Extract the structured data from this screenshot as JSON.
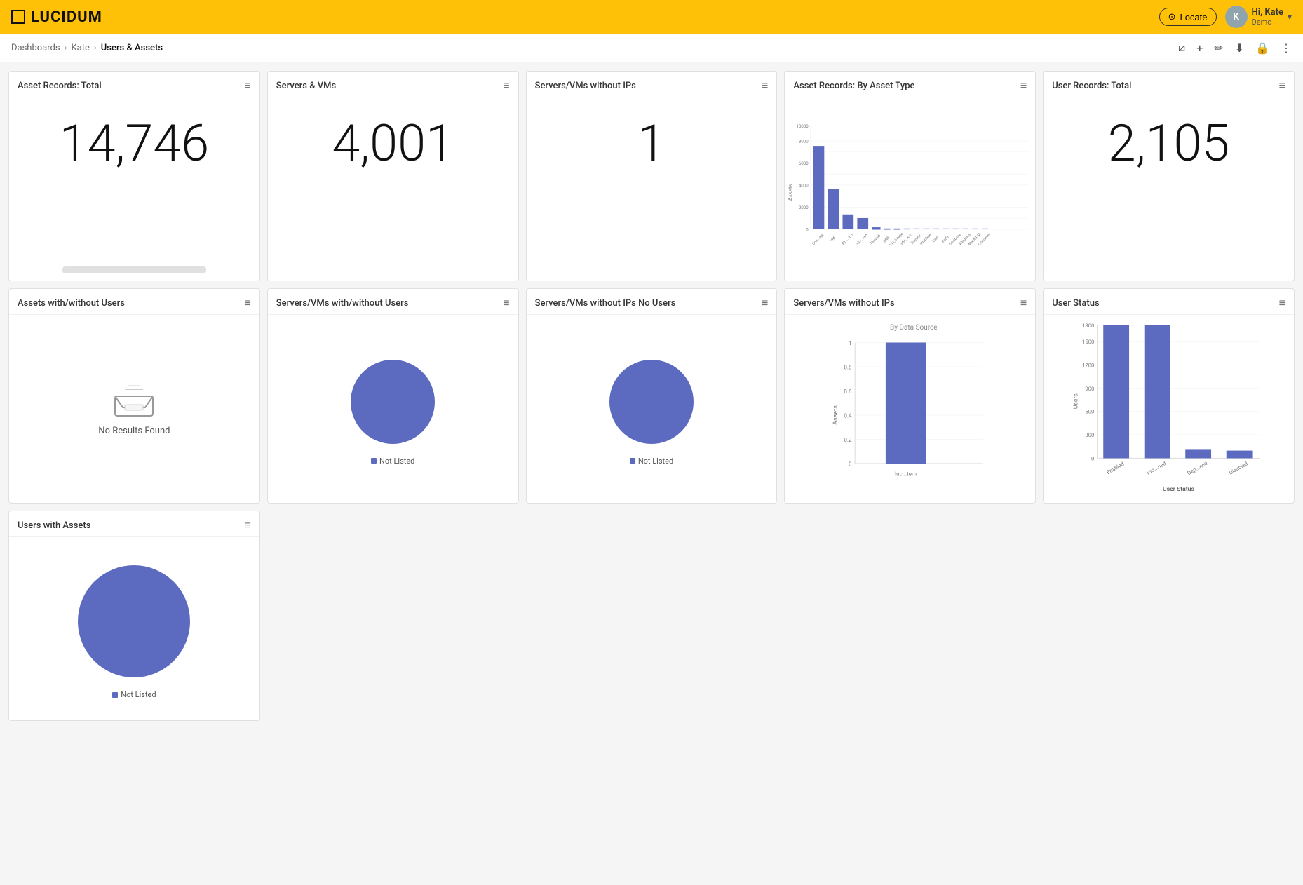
{
  "header": {
    "logo_text": "LUCIDUM",
    "locate_label": "Locate",
    "user_initial": "K",
    "user_name": "Hi, Kate",
    "user_sub": "Demo"
  },
  "breadcrumb": {
    "items": [
      "Dashboards",
      "Kate"
    ],
    "current": "Users & Assets"
  },
  "toolbar": {
    "icons": [
      "filter",
      "add",
      "edit",
      "download",
      "lock",
      "more"
    ]
  },
  "widgets": {
    "row1": [
      {
        "id": "asset-records-total",
        "title": "Asset Records: Total",
        "type": "big_number",
        "value": "14,746"
      },
      {
        "id": "servers-vms",
        "title": "Servers & VMs",
        "type": "big_number",
        "value": "4,001"
      },
      {
        "id": "servers-vms-no-ips",
        "title": "Servers/VMs without IPs",
        "type": "big_number",
        "value": "1"
      },
      {
        "id": "asset-records-by-type",
        "title": "Asset Records: By Asset Type",
        "type": "bar_chart",
        "bars": [
          {
            "label": "Con...agt",
            "value": 8000
          },
          {
            "label": "VM",
            "value": 3800
          },
          {
            "label": "Wor...ion",
            "value": 1400
          },
          {
            "label": "Not...ted",
            "value": 1050
          },
          {
            "label": "Firewall",
            "value": 200
          },
          {
            "label": "DNS",
            "value": 50
          },
          {
            "label": "VM_Image",
            "value": 30
          },
          {
            "label": "Mic...ice",
            "value": 25
          },
          {
            "label": "Storage",
            "value": 20
          },
          {
            "label": "Interface",
            "value": 15
          },
          {
            "label": "Cert",
            "value": 12
          },
          {
            "label": "Code",
            "value": 10
          },
          {
            "label": "Database",
            "value": 8
          },
          {
            "label": "Windows",
            "value": 6
          },
          {
            "label": "MacMDM",
            "value": 4
          },
          {
            "label": "Container",
            "value": 3
          }
        ],
        "y_max": 10000,
        "y_labels": [
          "0",
          "2000",
          "4000",
          "6000",
          "8000",
          "10000"
        ],
        "y_axis_label": "Assets"
      },
      {
        "id": "user-records-total",
        "title": "User Records: Total",
        "type": "big_number",
        "value": "2,105"
      }
    ],
    "row2": [
      {
        "id": "assets-with-without-users",
        "title": "Assets with/without Users",
        "type": "no_results",
        "no_results_text": "No Results Found"
      },
      {
        "id": "servers-vms-with-without-users",
        "title": "Servers/VMs with/without Users",
        "type": "pie",
        "label": "Not Listed"
      },
      {
        "id": "servers-vms-no-ips-no-users",
        "title": "Servers/VMs without IPs No Users",
        "type": "pie",
        "label": "Not Listed"
      },
      {
        "id": "servers-vms-no-ips-datasource",
        "title": "Servers/VMs without IPs",
        "type": "bar_chart_single",
        "sub_label": "By Data Source",
        "bars": [
          {
            "label": "luc...tem",
            "value": 1
          }
        ],
        "y_axis_label": "Assets",
        "x_axis_label": "luc...tem"
      },
      {
        "id": "user-status",
        "title": "User Status",
        "type": "user_status_chart",
        "bars": [
          {
            "label": "Enabled",
            "value": 1700
          },
          {
            "label": "Pro...ned",
            "value": 1700
          },
          {
            "label": "Dep...ned",
            "value": 110
          },
          {
            "label": "Disabled",
            "value": 100
          }
        ],
        "y_max": 1800,
        "y_labels": [
          "0",
          "300",
          "600",
          "900",
          "1200",
          "1500",
          "1800"
        ],
        "y_axis_label": "Users",
        "x_axis_label": "User Status"
      },
      {
        "id": "users-with-assets",
        "title": "Users with Assets",
        "type": "pie_large",
        "label": "Not Listed"
      }
    ]
  }
}
